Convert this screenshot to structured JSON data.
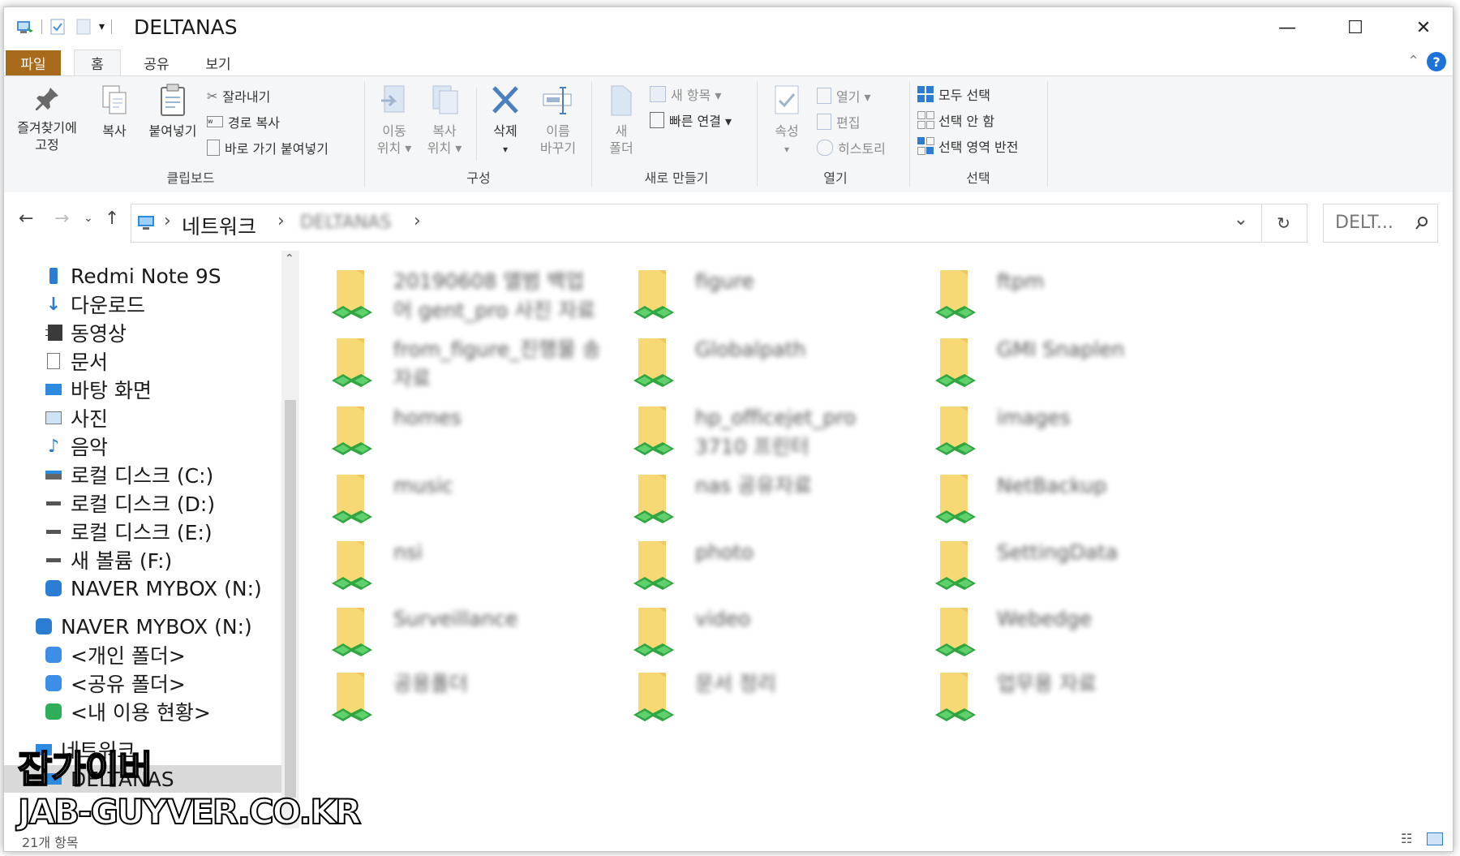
{
  "window": {
    "title": "DELTANAS",
    "minimize": "—",
    "maximize": "☐",
    "close": "✕"
  },
  "ribbon_tabs": [
    {
      "label": "파일"
    },
    {
      "label": "홈"
    },
    {
      "label": "공유"
    },
    {
      "label": "보기"
    }
  ],
  "ribbon": {
    "clipboard": {
      "pin_line1": "즐겨찾기에",
      "pin_line2": "고정",
      "copy": "복사",
      "paste": "붙여넣기",
      "cut": "잘라내기",
      "copy_path": "경로 복사",
      "paste_shortcut": "바로 가기 붙여넣기",
      "label": "클립보드"
    },
    "organize": {
      "move_line1": "이동",
      "move_line2": "위치 ▾",
      "copyto_line1": "복사",
      "copyto_line2": "위치 ▾",
      "delete": "삭제",
      "delete_arrow": "▾",
      "rename_line1": "이름",
      "rename_line2": "바꾸기",
      "label": "구성"
    },
    "new": {
      "folder_line1": "새",
      "folder_line2": "폴더",
      "new_item": "새 항목 ▾",
      "easy_access": "빠른 연결 ▾",
      "label": "새로 만들기"
    },
    "open": {
      "properties": "속성",
      "properties_arrow": "▾",
      "open": "열기 ▾",
      "edit": "편집",
      "history": "히스토리",
      "label": "열기"
    },
    "select": {
      "select_all": "모두 선택",
      "select_none": "선택 안 함",
      "invert": "선택 영역 반전",
      "label": "선택"
    }
  },
  "address": {
    "crumb_network": "네트워크",
    "crumb_host": "DELTANAS",
    "search_placeholder": "DELT...",
    "chevron": "›",
    "dropdown": "⌄"
  },
  "nav_items": [
    {
      "label": "Redmi Note 9S",
      "icon": "phone-icon"
    },
    {
      "label": "다운로드",
      "icon": "download-icon"
    },
    {
      "label": "동영상",
      "icon": "video-icon"
    },
    {
      "label": "문서",
      "icon": "document-icon"
    },
    {
      "label": "바탕 화면",
      "icon": "desktop-icon"
    },
    {
      "label": "사진",
      "icon": "picture-icon"
    },
    {
      "label": "음악",
      "icon": "music-icon"
    },
    {
      "label": "로컬 디스크 (C:)",
      "icon": "system-drive-icon"
    },
    {
      "label": "로컬 디스크 (D:)",
      "icon": "drive-icon"
    },
    {
      "label": "로컬 디스크 (E:)",
      "icon": "drive-icon"
    },
    {
      "label": "새 볼륨 (F:)",
      "icon": "drive-icon"
    },
    {
      "label": "NAVER MYBOX (N:)",
      "icon": "mybox-icon"
    },
    {
      "label": "NAVER MYBOX (N:)",
      "icon": "mybox-icon"
    },
    {
      "label": "<개인 폴더>",
      "icon": "mybox-folder-icon"
    },
    {
      "label": "<공유 폴더>",
      "icon": "mybox-folder-icon"
    },
    {
      "label": "<내 이용 현황>",
      "icon": "mybox-info-icon"
    },
    {
      "label": "네트워크",
      "icon": "network-icon"
    },
    {
      "label": "DELTANAS",
      "icon": "computer-icon"
    }
  ],
  "folders": [
    {
      "name": "20190608 앨범 백업 어 gent_pro 사진 자료",
      "suffix": "어"
    },
    {
      "name": "figure",
      "suffix": ""
    },
    {
      "name": "ftpm",
      "suffix": ""
    },
    {
      "name": "from_figure_진행물 송 자료",
      "suffix": "송"
    },
    {
      "name": "Globalpath",
      "suffix": ""
    },
    {
      "name": "GMI Snaplen",
      "suffix": ""
    },
    {
      "name": "homes",
      "suffix": ""
    },
    {
      "name": "hp_officejet_pro 3710 프린터",
      "suffix": "3710"
    },
    {
      "name": "images",
      "suffix": ""
    },
    {
      "name": "music",
      "suffix": ""
    },
    {
      "name": "nas 공유자료",
      "suffix": ""
    },
    {
      "name": "NetBackup",
      "suffix": ""
    },
    {
      "name": "nsi",
      "suffix": ""
    },
    {
      "name": "photo",
      "suffix": ""
    },
    {
      "name": "SettingData",
      "suffix": ""
    },
    {
      "name": "Surveillance",
      "suffix": ""
    },
    {
      "name": "video",
      "suffix": ""
    },
    {
      "name": "Webedge",
      "suffix": ""
    },
    {
      "name": "공용폴더",
      "suffix": ""
    },
    {
      "name": "문서 정리",
      "suffix": ""
    },
    {
      "name": "업무용 자료",
      "suffix": ""
    }
  ],
  "status": {
    "count": "21개 항목"
  },
  "watermark": {
    "line1": "잡가이버",
    "line2": "JAB-GUYVER.CO.KR"
  }
}
